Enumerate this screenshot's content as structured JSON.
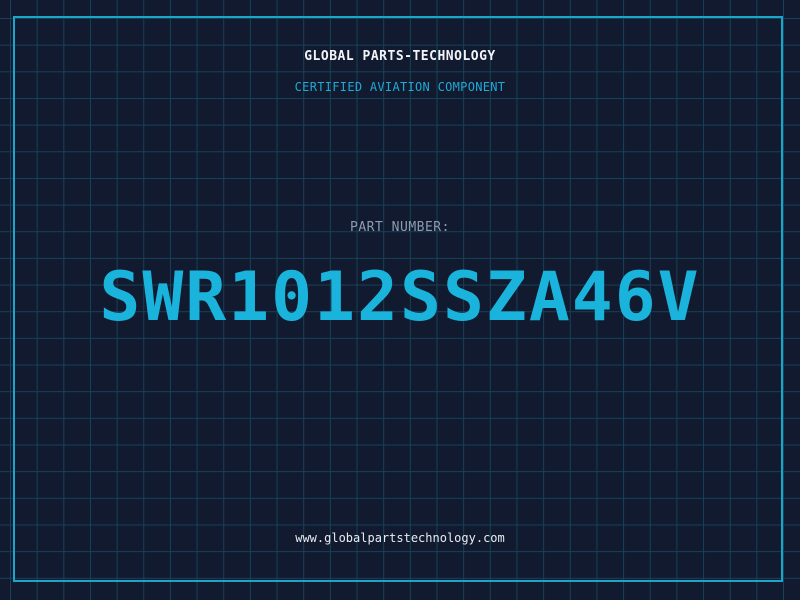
{
  "header": {
    "company_name": "GLOBAL PARTS-TECHNOLOGY",
    "subtitle": "CERTIFIED AVIATION COMPONENT"
  },
  "part": {
    "label": "PART NUMBER:",
    "number": "SWR1012SSZA46V"
  },
  "footer": {
    "website": "www.globalpartstechnology.com"
  },
  "colors": {
    "background": "#111a2e",
    "grid": "#17415a",
    "accent": "#1ab3dc",
    "frame": "#1aa6c9",
    "label": "#8e9bb0",
    "text": "#f2f4f8"
  }
}
